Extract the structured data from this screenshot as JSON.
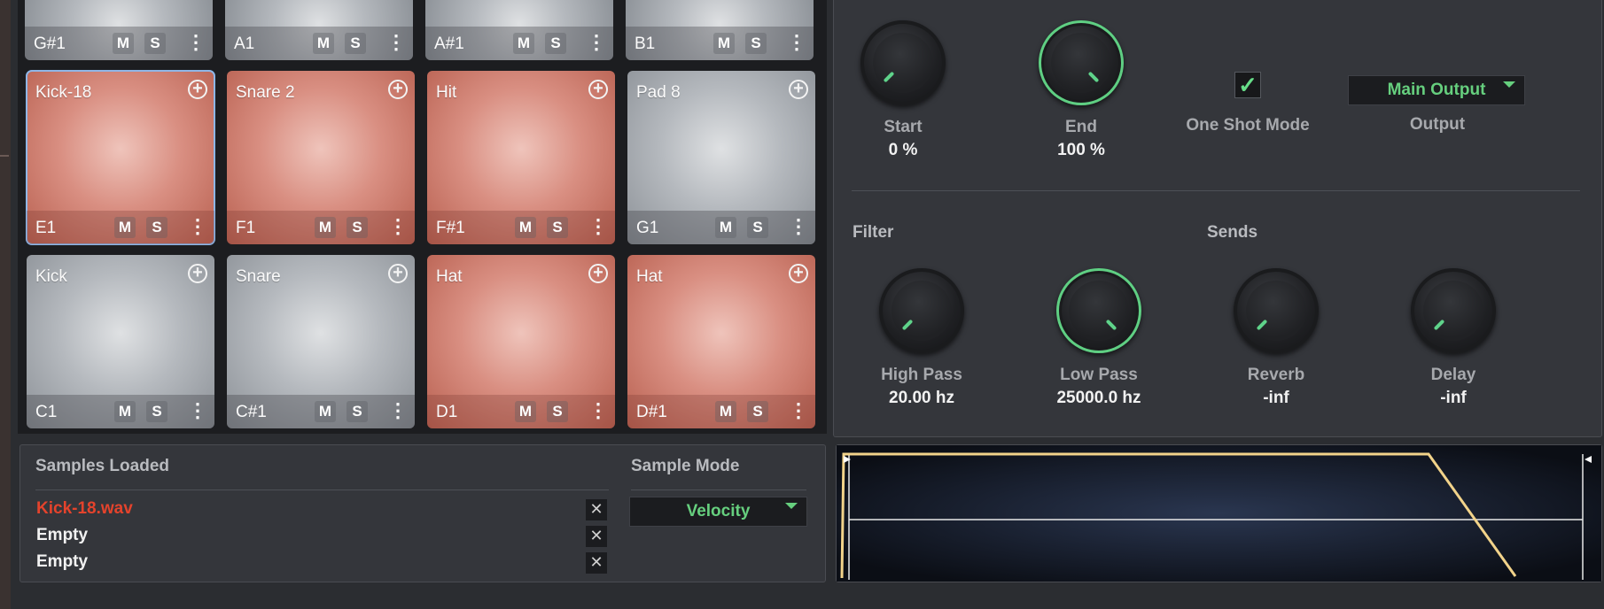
{
  "pads_top_row": [
    {
      "note": "G#1"
    },
    {
      "note": "A1"
    },
    {
      "note": "A#1"
    },
    {
      "note": "B1"
    }
  ],
  "pads_middle_row": [
    {
      "name": "Kick-18",
      "note": "E1",
      "color": "red",
      "selected": true
    },
    {
      "name": "Snare 2",
      "note": "F1",
      "color": "red"
    },
    {
      "name": "Hit",
      "note": "F#1",
      "color": "red"
    },
    {
      "name": "Pad 8",
      "note": "G1",
      "color": "gray"
    }
  ],
  "pads_bottom_row": [
    {
      "name": "Kick",
      "note": "C1",
      "color": "gray"
    },
    {
      "name": "Snare",
      "note": "C#1",
      "color": "gray"
    },
    {
      "name": "Hat",
      "note": "D1",
      "color": "red"
    },
    {
      "name": "Hat",
      "note": "D#1",
      "color": "red"
    }
  ],
  "pad_buttons": {
    "mute": "M",
    "solo": "S",
    "menu": "⋮",
    "add": "+"
  },
  "controls": {
    "start": {
      "label": "Start",
      "value": "0 %"
    },
    "end": {
      "label": "End",
      "value": "100 %"
    },
    "one_shot": {
      "label": "One Shot Mode",
      "checked": true,
      "check_glyph": "✓"
    },
    "output": {
      "label": "Output",
      "selected": "Main Output"
    }
  },
  "filter": {
    "section_label": "Filter",
    "high_pass": {
      "label": "High Pass",
      "value": "20.00 hz"
    },
    "low_pass": {
      "label": "Low Pass",
      "value": "25000.0 hz"
    }
  },
  "sends": {
    "section_label": "Sends",
    "reverb": {
      "label": "Reverb",
      "value": "-inf"
    },
    "delay": {
      "label": "Delay",
      "value": "-inf"
    }
  },
  "samples": {
    "title": "Samples Loaded",
    "items": [
      "Kick-18.wav",
      "Empty",
      "Empty"
    ],
    "remove_glyph": "✕"
  },
  "sample_mode": {
    "label": "Sample Mode",
    "selected": "Velocity"
  },
  "colors": {
    "accent_green": "#5fd38a",
    "pad_red": "#d98f82",
    "pad_gray": "#b5b9be",
    "active_sample": "#e4432c",
    "envelope": "#f2d38a"
  }
}
